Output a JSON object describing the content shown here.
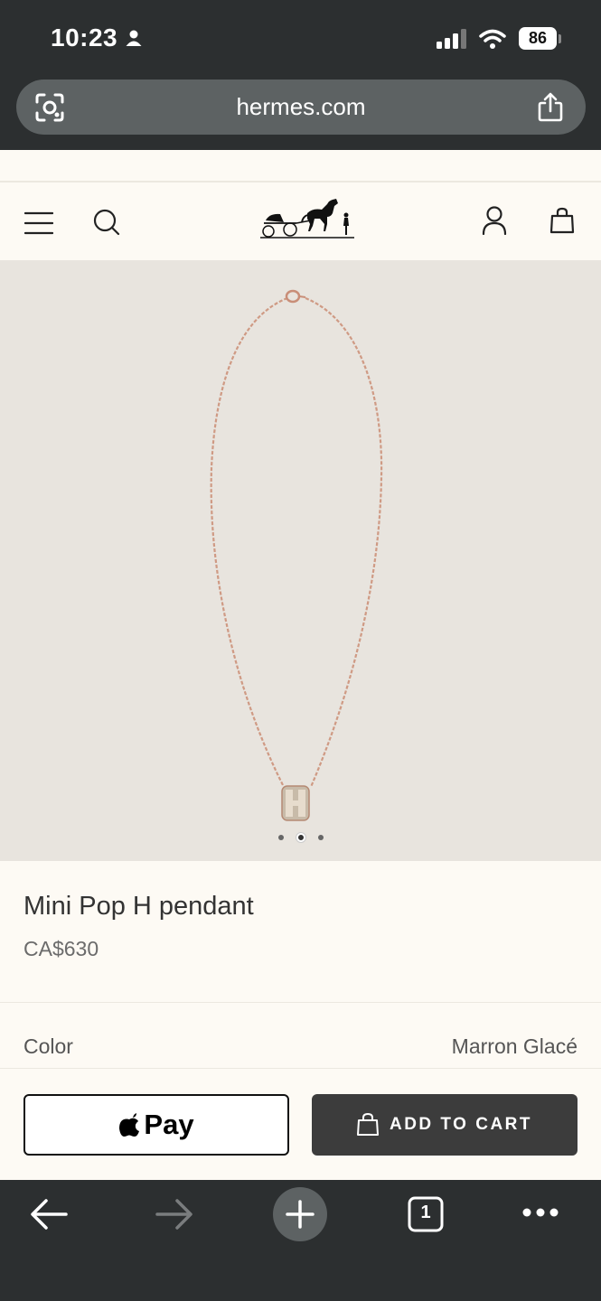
{
  "status_bar": {
    "time": "10:23",
    "battery": "86"
  },
  "browser": {
    "url": "hermes.com",
    "tab_count": "1"
  },
  "site": {
    "brand_logo_alt": "Hermès carriage logo",
    "icons": [
      "menu-icon",
      "search-icon",
      "account-icon",
      "bag-icon"
    ]
  },
  "carousel": {
    "total": 3,
    "active_index": 1
  },
  "product": {
    "title": "Mini Pop H pendant",
    "price": "CA$630",
    "color_label": "Color",
    "color_value": "Marron Glacé"
  },
  "actions": {
    "apple_pay_label": "Pay",
    "add_to_cart_label": "ADD TO CART"
  },
  "colors": {
    "chrome_dark": "#2c2f30",
    "page_bg": "#fdfaf4",
    "image_bg": "#e8e4de",
    "cart_button": "#3c3c3c"
  }
}
